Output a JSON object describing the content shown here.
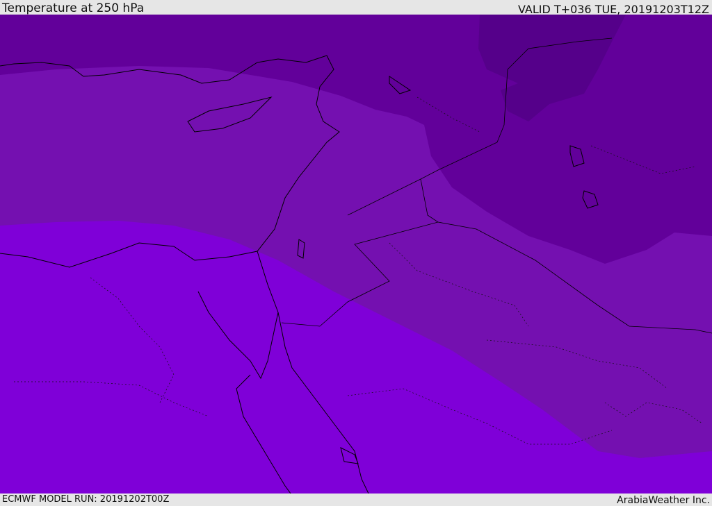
{
  "header": {
    "title": "Temperature at 250 hPa",
    "valid": "VALID T+036 TUE, 20191203T12Z"
  },
  "footer": {
    "model_run": "ECMWF MODEL RUN: 20191202T00Z",
    "credit": "ArabiaWeather Inc."
  },
  "colors": {
    "band_coldest": "#55008a",
    "band_cold": "#62009a",
    "band_mid": "#7410b0",
    "band_warm": "#7f00d8",
    "coastline": "#000000",
    "bar_background": "#e6e6e6"
  }
}
